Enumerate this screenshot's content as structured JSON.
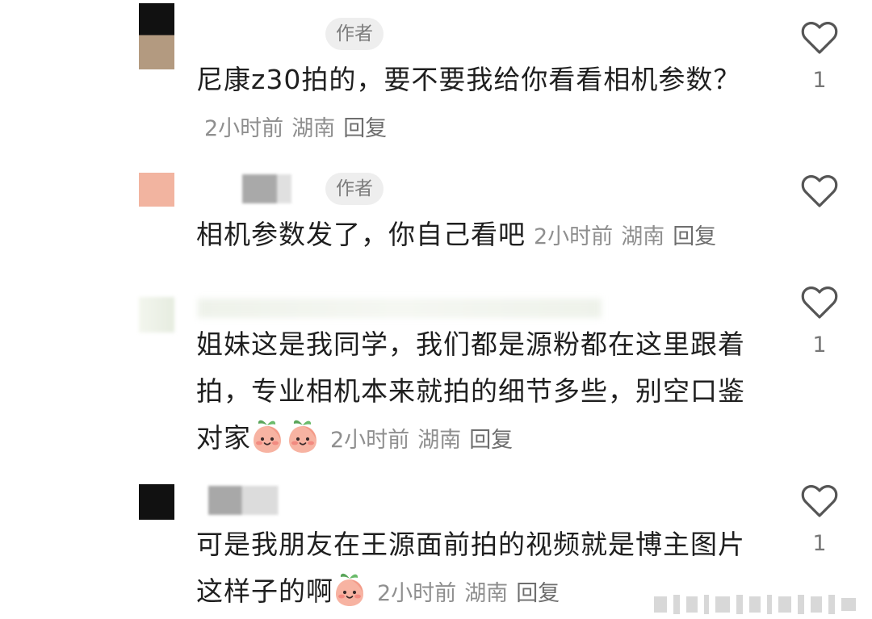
{
  "comments": [
    {
      "author_badge": "作者",
      "text": "尼康z30拍的，要不要我给你看看相机参数？",
      "time": "2小时前",
      "location": "湖南",
      "reply": "回复",
      "likes": "1"
    },
    {
      "author_badge": "作者",
      "text": "相机参数发了，你自己看吧",
      "time": "2小时前",
      "location": "湖南",
      "reply": "回复",
      "likes": ""
    },
    {
      "text": "姐妹这是我同学，我们都是源粉都在这里跟着拍，专业相机本来就拍的细节多些，别空口鉴对家",
      "time": "2小时前",
      "location": "湖南",
      "reply": "回复",
      "likes": "1"
    },
    {
      "text": "可是我朋友在王源面前拍的视频就是博主图片这样子的啊",
      "time": "2小时前",
      "location": "湖南",
      "reply": "回复",
      "likes": "1"
    }
  ],
  "icons": {
    "like": "heart-outline-icon",
    "emoji": "peach-face-emoji"
  },
  "colors": {
    "text": "#1f1f1f",
    "meta": "#8f8f8f",
    "badge_bg": "#eeeeee",
    "heart_stroke": "#555555"
  }
}
